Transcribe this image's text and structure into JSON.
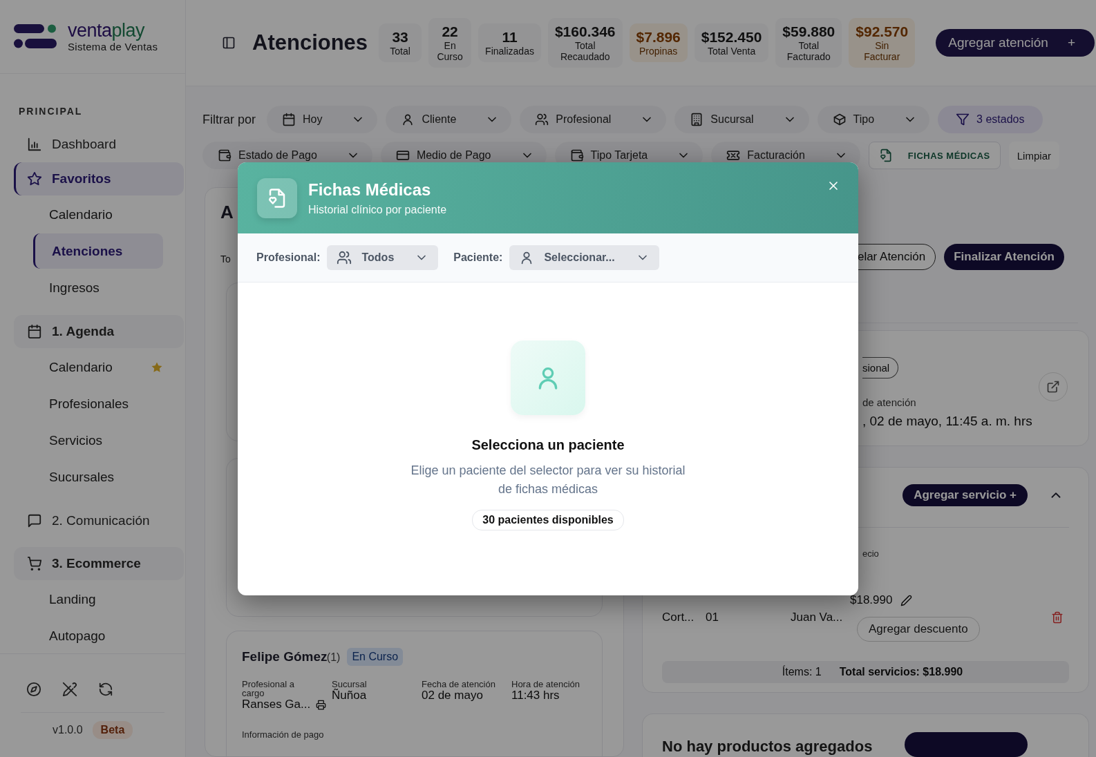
{
  "brand": {
    "name_parts": [
      "venta",
      "play"
    ],
    "tagline": "Sistema de Ventas"
  },
  "sidebar": {
    "section_title": "PRINCIPAL",
    "items": [
      {
        "label": "Dashboard",
        "selected": false,
        "expanded": false
      },
      {
        "label": "Favoritos",
        "selected": true,
        "expanded": true,
        "children": [
          {
            "label": "Calendario",
            "selected": false,
            "favorite": false
          },
          {
            "label": "Atenciones",
            "selected": true,
            "favorite": false
          },
          {
            "label": "Ingresos",
            "selected": false,
            "favorite": false
          }
        ]
      },
      {
        "label": "1. Agenda",
        "selected": false,
        "expanded": true,
        "children": [
          {
            "label": "Calendario",
            "selected": false,
            "favorite": true
          },
          {
            "label": "Profesionales",
            "selected": false,
            "favorite": false
          },
          {
            "label": "Servicios",
            "selected": false,
            "favorite": false
          },
          {
            "label": "Sucursales",
            "selected": false,
            "favorite": false
          }
        ]
      },
      {
        "label": "2. Comunicación",
        "selected": false,
        "expanded": false
      },
      {
        "label": "3. Ecommerce",
        "selected": false,
        "expanded": true,
        "children": [
          {
            "label": "Landing",
            "selected": false,
            "favorite": false
          },
          {
            "label": "Autopago",
            "selected": false,
            "favorite": false
          }
        ]
      }
    ],
    "version": "v1.0.0",
    "badge": "Beta"
  },
  "header": {
    "title": "Atenciones",
    "stats": [
      {
        "value": "33",
        "label": "Total",
        "highlight": false
      },
      {
        "value": "22",
        "label": "En Curso",
        "highlight": false
      },
      {
        "value": "11",
        "label": "Finalizadas",
        "highlight": false
      },
      {
        "value": "$160.346",
        "label": "Total Recaudado",
        "highlight": false
      },
      {
        "value": "$7.896",
        "label": "Propinas",
        "highlight": true
      },
      {
        "value": "$152.450",
        "label": "Total Venta",
        "highlight": false
      },
      {
        "value": "$59.880",
        "label": "Total Facturado",
        "highlight": false
      },
      {
        "value": "$92.570",
        "label": "Sin Facturar",
        "highlight": true
      }
    ],
    "add_button": {
      "label": "Agregar atención",
      "symbol": "+"
    }
  },
  "filters": {
    "label": "Filtrar por",
    "row_1": [
      {
        "label": "Hoy",
        "kind": "dropdown"
      },
      {
        "label": "Cliente",
        "kind": "dropdown"
      },
      {
        "label": "Profesional",
        "kind": "dropdown"
      },
      {
        "label": "Sucursal",
        "kind": "dropdown"
      },
      {
        "label": "Tipo",
        "kind": "dropdown"
      },
      {
        "label": "3 estados",
        "kind": "status"
      }
    ],
    "row_2": [
      {
        "label": "Estado de Pago",
        "kind": "dropdown"
      },
      {
        "label": "Medio de Pago",
        "kind": "dropdown"
      },
      {
        "label": "Tipo Tarjeta",
        "kind": "dropdown"
      },
      {
        "label": "Facturación",
        "kind": "dropdown"
      },
      {
        "label": "FICHAS MÉDICAS",
        "kind": "feature"
      },
      {
        "label": "Limpiar",
        "kind": "plain"
      }
    ]
  },
  "list_panel": {
    "title_fragment": "A",
    "tab_fragment": "To",
    "card": {
      "name": "Felipe Gómez",
      "count": "(1)",
      "status": "En Curso",
      "fields": [
        {
          "label": "Profesional a cargo",
          "value": "Ranses Ga..."
        },
        {
          "label": "Sucursal",
          "value": "Ñuñoa"
        },
        {
          "label": "Fecha de atención",
          "value": "02 de mayo"
        },
        {
          "label": "Hora de atención",
          "value": "11:43 hrs"
        }
      ],
      "section_label": "Información de pago"
    }
  },
  "detail": {
    "actions": [
      {
        "label": "elar Atención",
        "kind": "outline"
      },
      {
        "label": "Finalizar Atención",
        "kind": "primary"
      }
    ],
    "info": {
      "chip": "sional",
      "label": "de atención",
      "value": ", 02 de mayo, 11:45 a. m. hrs"
    },
    "services": {
      "add_button": "Agregar servicio +",
      "column_label": "ecio",
      "rows": [
        {
          "name": "Cort...",
          "qty": "01",
          "professional": "Juan Va...",
          "price": "$18.990",
          "discount_button": "Agregar descuento"
        }
      ],
      "summary": {
        "items": "Ítems: 1",
        "total": "Total servicios: $18.990"
      }
    },
    "products": {
      "empty_text": "No hay productos agregados"
    }
  },
  "modal": {
    "title": "Fichas Médicas",
    "subtitle": "Historial clínico por paciente",
    "filters": [
      {
        "label": "Profesional:",
        "value": "Todos",
        "kind": "group"
      },
      {
        "label": "Paciente:",
        "placeholder": "Seleccionar...",
        "kind": "person"
      }
    ],
    "empty_state": {
      "title": "Selecciona un paciente",
      "description": "Elige un paciente del selector para ver su historial de fichas médicas",
      "count": "30 pacientes disponibles"
    }
  }
}
